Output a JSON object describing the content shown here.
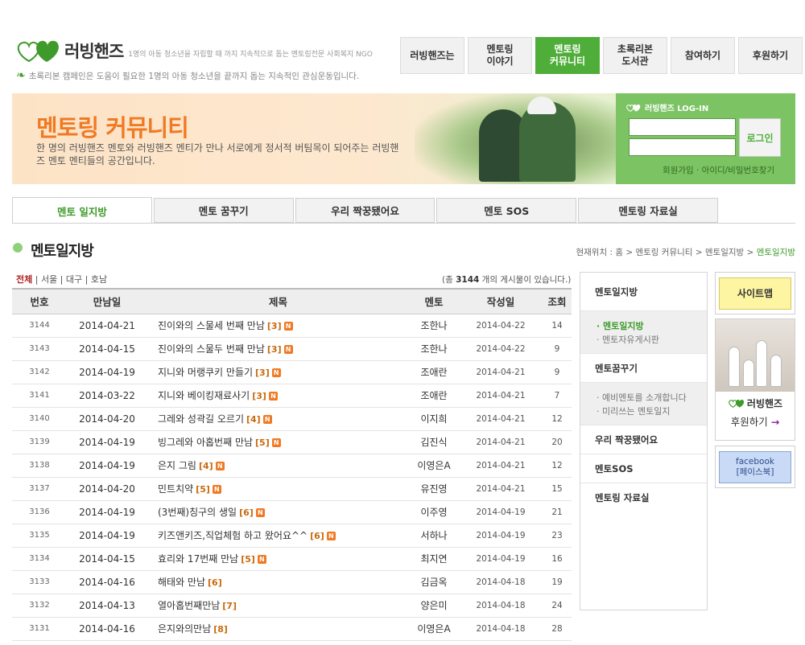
{
  "brand": {
    "name": "러빙핸즈",
    "tagline": "1명의 아동 청소년을 자립할 때 까지 지속적으로 돕는 멘토링전문 사회복지 NGO",
    "campaign": "초록리본 캠페인은 도움이 필요한 1명의 아동 청소년을 끝까지 돕는 지속적인 관심운동입니다."
  },
  "gnb": [
    {
      "label": "러빙핸즈는"
    },
    {
      "label": "멘토링\n이야기"
    },
    {
      "label": "멘토링\n커뮤니티"
    },
    {
      "label": "초록리본\n도서관"
    },
    {
      "label": "참여하기"
    },
    {
      "label": "후원하기"
    }
  ],
  "banner": {
    "title": "멘토링 커뮤니티",
    "desc": "한 명의 러빙핸즈 멘토와 러빙핸즈 멘티가 만나 서로에게 정서적 버팀목이 되어주는 러빙핸즈 멘토 멘티들의 공간입니다."
  },
  "login": {
    "title": "러빙핸즈 LOG-IN",
    "button": "로그인",
    "links": "회원가입 · 아이디/비밀번호찾기"
  },
  "tabs": [
    "멘토 일지방",
    "멘토 꿈꾸기",
    "우리 짝꿍됐어요",
    "멘토 SOS",
    "멘토링 자료실"
  ],
  "section": {
    "title": "멘토일지방",
    "breadcrumb_prefix": "현재위치 : 홈 > 멘토링 커뮤니티 > 멘토일지방 > ",
    "breadcrumb_current": "멘토일지방"
  },
  "filters": {
    "active": "전체",
    "others": " | 서울 | 대구 | 호남"
  },
  "total": {
    "prefix": "(총 ",
    "count": "3144",
    "suffix": " 개의 게시물이 있습니다.)"
  },
  "board": {
    "headers": [
      "번호",
      "만남일",
      "제목",
      "멘토",
      "작성일",
      "조회"
    ],
    "rows": [
      {
        "no": "3144",
        "date": "2014-04-21",
        "title": "진이와의 스물세 번째 만남",
        "cmt": "[3]",
        "new": true,
        "mentor": "조한나",
        "wdate": "2014-04-22",
        "views": "14"
      },
      {
        "no": "3143",
        "date": "2014-04-15",
        "title": "진이와의 스물두 번째 만남",
        "cmt": "[3]",
        "new": true,
        "mentor": "조한나",
        "wdate": "2014-04-22",
        "views": "9"
      },
      {
        "no": "3142",
        "date": "2014-04-19",
        "title": "지니와 머랭쿠키 만들기",
        "cmt": "[3]",
        "new": true,
        "mentor": "조애란",
        "wdate": "2014-04-21",
        "views": "9"
      },
      {
        "no": "3141",
        "date": "2014-03-22",
        "title": "지니와 베이킹재료사기",
        "cmt": "[3]",
        "new": true,
        "mentor": "조애란",
        "wdate": "2014-04-21",
        "views": "7"
      },
      {
        "no": "3140",
        "date": "2014-04-20",
        "title": "그레와 성곽길 오르기",
        "cmt": "[4]",
        "new": true,
        "mentor": "이지희",
        "wdate": "2014-04-21",
        "views": "12"
      },
      {
        "no": "3139",
        "date": "2014-04-19",
        "title": "빙그레와 아홉번째 만남",
        "cmt": "[5]",
        "new": true,
        "mentor": "김진식",
        "wdate": "2014-04-21",
        "views": "20"
      },
      {
        "no": "3138",
        "date": "2014-04-19",
        "title": "은지 그림",
        "cmt": "[4]",
        "new": true,
        "mentor": "이영은A",
        "wdate": "2014-04-21",
        "views": "12"
      },
      {
        "no": "3137",
        "date": "2014-04-20",
        "title": "민트치약",
        "cmt": "[5]",
        "new": true,
        "mentor": "유진영",
        "wdate": "2014-04-21",
        "views": "15"
      },
      {
        "no": "3136",
        "date": "2014-04-19",
        "title": "(3번째)칭구의 생일",
        "cmt": "[6]",
        "new": true,
        "mentor": "이주영",
        "wdate": "2014-04-19",
        "views": "21"
      },
      {
        "no": "3135",
        "date": "2014-04-19",
        "title": "키즈앤키즈,직업체험 하고 왔어요^^",
        "cmt": "[6]",
        "new": true,
        "mentor": "서하나",
        "wdate": "2014-04-19",
        "views": "23"
      },
      {
        "no": "3134",
        "date": "2014-04-15",
        "title": "효리와 17번째 만남",
        "cmt": "[5]",
        "new": true,
        "mentor": "최지연",
        "wdate": "2014-04-19",
        "views": "16"
      },
      {
        "no": "3133",
        "date": "2014-04-16",
        "title": "해태와 만남",
        "cmt": "[6]",
        "new": false,
        "mentor": "김금옥",
        "wdate": "2014-04-18",
        "views": "19"
      },
      {
        "no": "3132",
        "date": "2014-04-13",
        "title": "열아홉번째만남",
        "cmt": "[7]",
        "new": false,
        "mentor": "양은미",
        "wdate": "2014-04-18",
        "views": "24"
      },
      {
        "no": "3131",
        "date": "2014-04-16",
        "title": "은지와의만남",
        "cmt": "[8]",
        "new": false,
        "mentor": "이영은A",
        "wdate": "2014-04-18",
        "views": "28"
      }
    ]
  },
  "lnb": {
    "items": [
      "멘토일지방",
      "멘토꿈꾸기",
      "우리 짝꿍됐어요",
      "멘토SOS",
      "멘토링 자료실"
    ],
    "sub1": [
      "· 멘토일지방",
      "· 멘토자유게시판"
    ],
    "sub2": [
      "· 예비멘토를 소개합니다",
      "· 미리쓰는 멘토일지"
    ]
  },
  "widgets": {
    "sitemap": "사이트맵",
    "donate_brand": "러빙핸즈",
    "donate_text": "후원하기",
    "donate_arrow": "→",
    "facebook_line1": "facebook",
    "facebook_line2": "[페이스북]"
  },
  "colors": {
    "accent": "#4fad3a",
    "banner_title": "#f07a24",
    "comment_count": "#c86b0e"
  },
  "new_badge_text": "N"
}
